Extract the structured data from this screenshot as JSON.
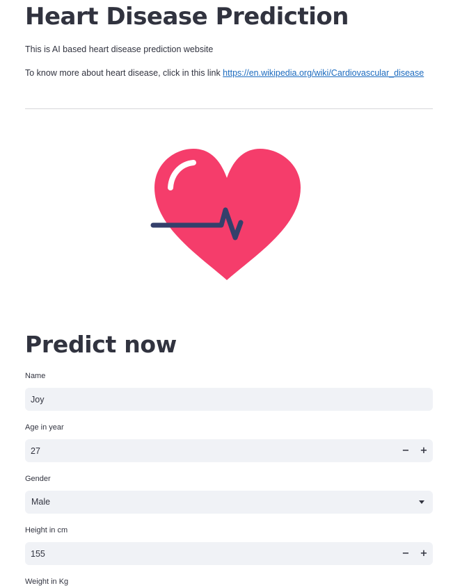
{
  "page": {
    "title": "Heart Disease Prediction",
    "intro": "This is AI based heart disease prediction website",
    "more_prefix": "To know more about heart disease, click in this link ",
    "link_text": "https://en.wikipedia.org/wiki/Cardiovascular_disease"
  },
  "image": {
    "name": "heart-with-pulse",
    "colors": {
      "heart": "#f53d6b",
      "pulse": "#34406b",
      "shine": "#ffffff"
    }
  },
  "form": {
    "heading": "Predict now",
    "name": {
      "label": "Name",
      "value": "Joy"
    },
    "age": {
      "label": "Age in year",
      "value": "27",
      "minus": "−",
      "plus": "+"
    },
    "gender": {
      "label": "Gender",
      "value": "Male"
    },
    "height": {
      "label": "Height in cm",
      "value": "155",
      "minus": "−",
      "plus": "+"
    },
    "weight": {
      "label": "Weight in Kg"
    }
  },
  "colors": {
    "text": "#31333f",
    "link": "#1c6bbf",
    "input_bg": "#f0f2f6",
    "divider": "#d6d6d9"
  }
}
